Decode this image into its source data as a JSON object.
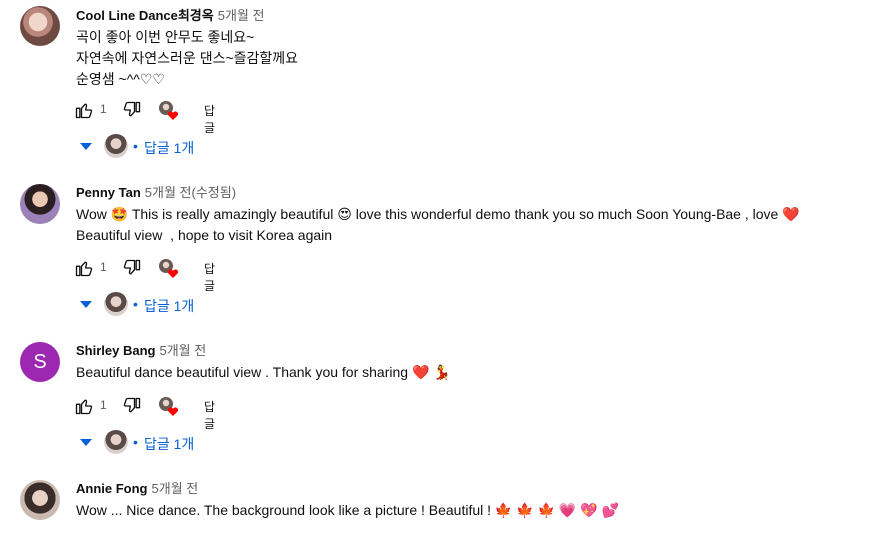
{
  "comments": [
    {
      "author": "Cool Line Dance최경옥",
      "time": "5개월 전",
      "lines": [
        "곡이 좋아 이번 안무도 좋네요~",
        "자연속에 자연스러운 댄스~즐감할께요",
        "순영샘 ~^^♡♡"
      ],
      "likes": "1",
      "reply_label": "답글",
      "replies_label": "답글 1개"
    },
    {
      "author": "Penny Tan",
      "time": "5개월 전(수정됨)",
      "lines": [
        "Wow 🤩 This is really amazingly beautiful 😍 love this wonderful demo thank you so much Soon Young-Bae , love ❤️",
        "Beautiful view  , hope to visit Korea again"
      ],
      "likes": "1",
      "reply_label": "답글",
      "replies_label": "답글 1개"
    },
    {
      "author": "Shirley Bang",
      "time": "5개월 전",
      "avatar_letter": "S",
      "lines": [
        "Beautiful dance beautiful view . Thank you for sharing ❤️ 💃"
      ],
      "likes": "1",
      "reply_label": "답글",
      "replies_label": "답글 1개"
    },
    {
      "author": "Annie Fong",
      "time": "5개월 전",
      "lines": [
        "Wow ... Nice dance. The background look like a picture ! Beautiful ! 🍁 🍁 🍁 💗 💖 💕"
      ]
    }
  ],
  "colors": {
    "link": "#065fd4",
    "heart": "#ff0000",
    "avatar_s": "#9c27b0"
  },
  "icons": [
    "thumb-up-icon",
    "thumb-down-icon",
    "creator-heart-icon",
    "expand-caret-icon"
  ]
}
